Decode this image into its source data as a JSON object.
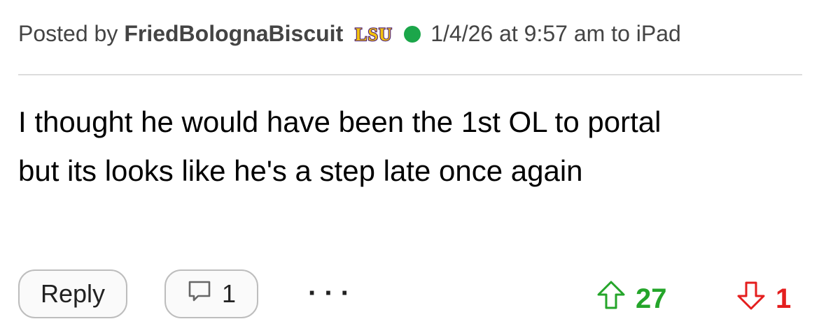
{
  "post": {
    "posted_by_label": "Posted by",
    "username": "FriedBolognaBiscuit",
    "team_logo_text": "LSU",
    "online_status_color": "#1ba64a",
    "meta": "1/4/26 at 9:57 am to iPad",
    "body_lines": [
      "I thought he would have been the 1st OL to portal",
      "but its looks like he's a step late once again"
    ]
  },
  "actions": {
    "reply_label": "Reply",
    "quote_count": "1",
    "more_label": "···",
    "upvotes": "27",
    "downvotes": "1",
    "upvote_color": "#24a52a",
    "downvote_color": "#e41e1e"
  },
  "icons": {
    "comment": "comment-icon",
    "upvote": "arrow-up-outline-icon",
    "downvote": "arrow-down-outline-icon"
  }
}
